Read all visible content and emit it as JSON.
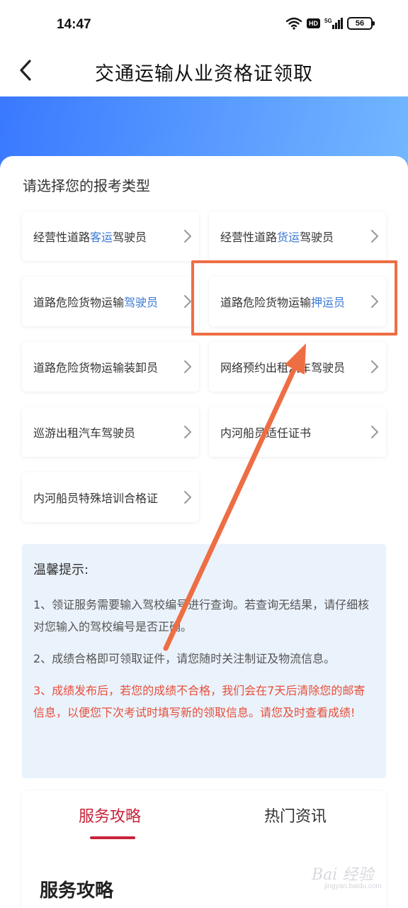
{
  "status_bar": {
    "time": "14:47",
    "hd_label": "HD",
    "network_label": "5G",
    "battery": "56"
  },
  "nav": {
    "title": "交通运输从业资格证领取"
  },
  "section": {
    "title": "请选择您的报考类型"
  },
  "options": [
    {
      "before": "经营性道路",
      "highlight": "客运",
      "after": "驾驶员"
    },
    {
      "before": "经营性道路",
      "highlight": "货运",
      "after": "驾驶员"
    },
    {
      "before": "道路危险货物运输",
      "highlight": "驾驶员",
      "after": ""
    },
    {
      "before": "道路危险货物运输",
      "highlight": "押运员",
      "after": ""
    },
    {
      "before": "道路危险货物运输装卸员",
      "highlight": "",
      "after": ""
    },
    {
      "before": "网络预约出租汽车驾驶员",
      "highlight": "",
      "after": ""
    },
    {
      "before": "巡游出租汽车驾驶员",
      "highlight": "",
      "after": ""
    },
    {
      "before": "内河船员适任证书",
      "highlight": "",
      "after": ""
    },
    {
      "before": "内河船员特殊培训合格证",
      "highlight": "",
      "after": ""
    }
  ],
  "tips": {
    "title": "温馨提示:",
    "items": [
      "1、领证服务需要输入驾校编号进行查询。若查询无结果，请仔细核对您输入的驾校编号是否正确。",
      "2、成绩合格即可领取证件，请您随时关注制证及物流信息。",
      "3、成绩发布后，若您的成绩不合格，我们会在7天后清除您的邮寄信息，以便您下次考试时填写新的领取信息。请您及时查看成绩!"
    ]
  },
  "tabs": [
    {
      "label": "服务攻略",
      "active": true
    },
    {
      "label": "热门资讯",
      "active": false
    }
  ],
  "content": {
    "heading": "服务攻略"
  },
  "watermark": {
    "text": "Bai 经验",
    "sub": "jingyan.baidu.com"
  },
  "colors": {
    "accent_blue": "#3a78d6",
    "tab_active_red": "#c8233a",
    "warning_red": "#e84e3a",
    "annotation_orange": "#ee6e44",
    "banner_start": "#3a79ff",
    "banner_end": "#72b8ff"
  }
}
